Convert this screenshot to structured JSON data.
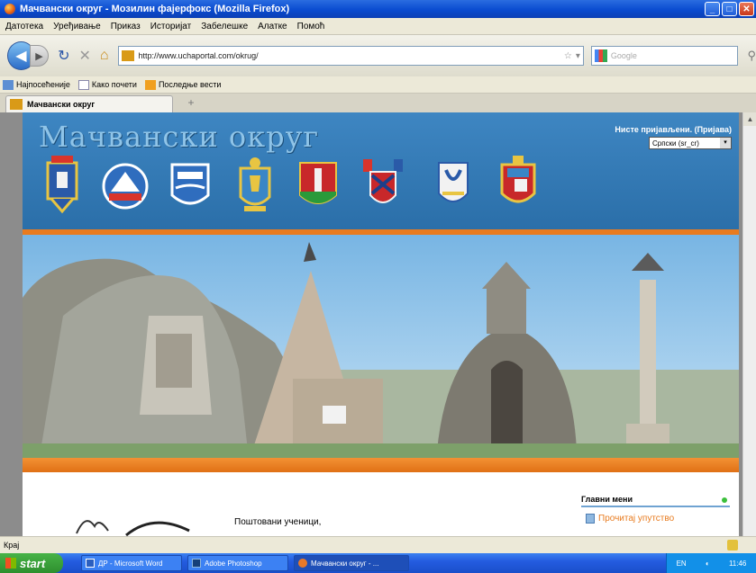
{
  "window": {
    "title": "Мачвански округ - Мозилин фајерфокс (Mozilla Firefox)"
  },
  "menu": {
    "items": [
      "Датотека",
      "Уређивање",
      "Приказ",
      "Историјат",
      "Забелешке",
      "Алатке",
      "Помоћ"
    ]
  },
  "nav": {
    "url": "http://www.uchaportal.com/okrug/",
    "search_placeholder": "Google"
  },
  "bookmarks": {
    "items": [
      "Најпосећеније",
      "Како почети",
      "Последње вести"
    ]
  },
  "tab": {
    "label": "Мачвански округ",
    "new_tab": "+"
  },
  "site": {
    "title": "Мачвански округ",
    "login_text": "Нисте пријављени. (Пријава)",
    "language": "Српски (sr_cr)",
    "greeting": "Поштовани ученици,",
    "menu_header": "Главни мени",
    "menu_link": "Прочитај упутство"
  },
  "status": {
    "text": "Крај"
  },
  "taskbar": {
    "start": "start",
    "tasks": [
      "ДР - Microsoft Word",
      "Adobe Photoshop",
      "Мачвански округ - ..."
    ],
    "lang": "EN",
    "clock": "11:46"
  },
  "colors": {
    "header_blue": "#3e86c2",
    "accent_orange": "#e87b1f",
    "xp_blue": "#245ce0"
  }
}
